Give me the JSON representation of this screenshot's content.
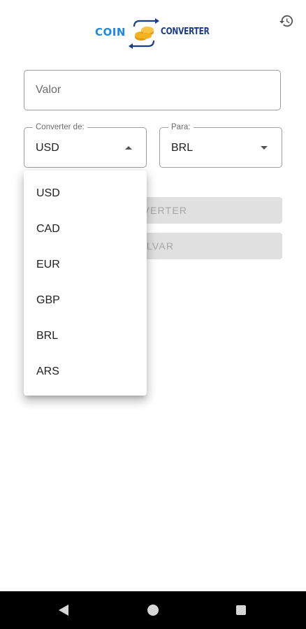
{
  "header": {
    "logo_text_left": "COIN",
    "logo_text_right": "CONVERTER",
    "history_icon": "history-icon"
  },
  "form": {
    "valor_placeholder": "Valor",
    "valor_value": "",
    "from": {
      "label": "Converter de:",
      "value": "USD",
      "expanded": true
    },
    "to": {
      "label": "Para:",
      "value": "BRL",
      "expanded": false
    },
    "convert_button_label": "CONVERTER",
    "save_button_label": "SALVAR",
    "buttons_disabled": true
  },
  "dropdown": {
    "options": [
      "USD",
      "CAD",
      "EUR",
      "GBP",
      "BRL",
      "ARS"
    ]
  },
  "colors": {
    "logo_coin": "#1e88e5",
    "logo_converter": "#1a3a8a",
    "coin_gold": "#f5b323",
    "button_disabled_bg": "#e0e0e0",
    "button_disabled_text": "#a6a6a6"
  },
  "navbar": {
    "back_icon": "back-triangle-icon",
    "home_icon": "home-circle-icon",
    "recents_icon": "recents-square-icon"
  }
}
